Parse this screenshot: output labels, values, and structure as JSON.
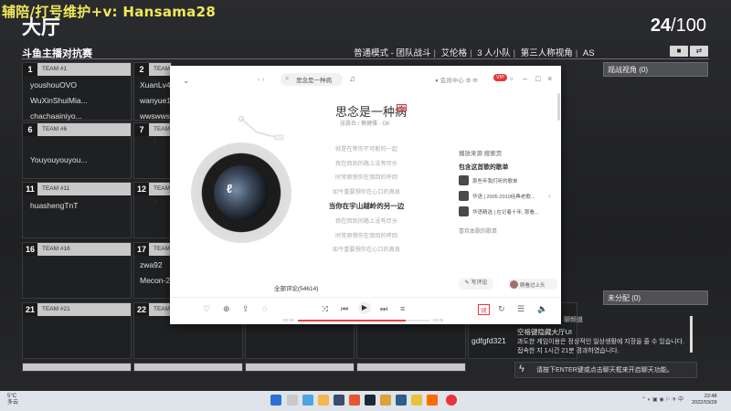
{
  "overlay": {
    "text": "辅陪/打号维护+v: Hansama28"
  },
  "lobby": {
    "title": "大厅",
    "player_count": "24",
    "player_max": "/100",
    "tourney_title": "斗鱼主播对抗赛",
    "modes": [
      "普通模式 - 团队战斗",
      "艾伦格",
      "3 人小队",
      "第三人称视角",
      "AS"
    ],
    "spectate_label": "观战视角 (0)",
    "unassigned_label": "未分配 (0)"
  },
  "teams": [
    {
      "num": "1",
      "label": "TEAM #1",
      "members": [
        "youshouOVO",
        "WuXinShuiMia...",
        "chachaainiyo..."
      ]
    },
    {
      "num": "2",
      "label": "TEAM #",
      "members": [
        "XuanLv4",
        "wanyue12",
        "wwswws-"
      ]
    },
    {
      "num": "6",
      "label": "TEAM #6",
      "members": [
        "",
        "Youyouyouyou..."
      ]
    },
    {
      "num": "7",
      "label": "TEAM #",
      "members": []
    },
    {
      "num": "11",
      "label": "TEAM #11",
      "members": [
        "huashengTnT"
      ]
    },
    {
      "num": "12",
      "label": "TEAM #",
      "members": []
    },
    {
      "num": "16",
      "label": "TEAM #16",
      "members": []
    },
    {
      "num": "17",
      "label": "TEAM #",
      "members": [
        "zwa92",
        "Mecon-2"
      ]
    },
    {
      "num": "21",
      "label": "TEAM #21",
      "members": []
    },
    {
      "num": "22",
      "label": "TEAM #",
      "members": []
    }
  ],
  "extra_player": "gdfgfd321",
  "chat": {
    "tab": "聊频道",
    "hint": "空格键隐藏大厅UI",
    "notice": "과도한 게임이용은 정상적인 일상생활에 지장을 줄 수 있습니다. 접속한 지 1시간 21분 경과하였습니다.",
    "input_placeholder": "请按下ENTER键或点击聊天框来开启聊天功能。"
  },
  "player": {
    "search_text": "思念是一种病",
    "song_title": "思念是一种病",
    "song_meta": "张震岳 / 蔡健雅 · OK",
    "lyrics": [
      "就是在等你不可能的一起",
      "我在回到的路上没有尽头",
      "时常原想你在我回的呼回",
      "如今重要想你在心口的鼻息",
      "当你在宇山越岭的另一边",
      "我在回到的路上没有尽头",
      "时常原想你在我回的呼回",
      "如今重要想你在心口的鼻息"
    ],
    "active_lyric_index": 4,
    "source": "播放来源  搜索页",
    "sheets_title": "包含这首歌的歌单",
    "sheets": [
      "那些年我们听的歌单",
      "华语 | 2005-2010经典老歌...",
      "华语精选 | 在记着十年, 那看..."
    ],
    "sheets_more": "喜欢本歌的歌单",
    "comments": "全部评论(54614)",
    "write_comment": "写评论",
    "listener": "刚看过上头",
    "time_now": "00:28",
    "time_total": "04:35",
    "progress": 0.82,
    "lyric_btn": "词",
    "account": "会员中心"
  },
  "taskbar": {
    "weather_temp": "5°C",
    "weather_desc": "多云",
    "clock_time": "22:48",
    "clock_date": "2022/03/28"
  }
}
